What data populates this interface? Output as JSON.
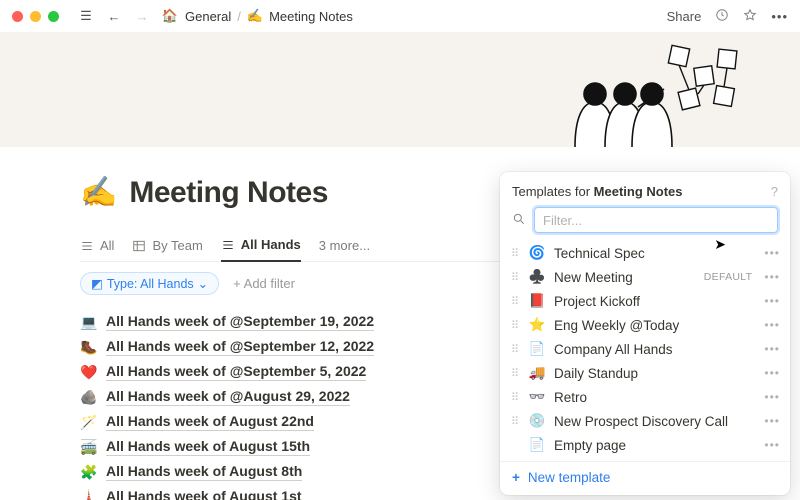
{
  "titlebar": {
    "crumb1": "General",
    "crumb2_icon": "✍️",
    "crumb2": "Meeting Notes",
    "share": "Share"
  },
  "page": {
    "icon": "✍️",
    "title": "Meeting Notes"
  },
  "tabs": {
    "all": "All",
    "byteam": "By Team",
    "allhands": "All Hands",
    "more": "3 more..."
  },
  "filters": {
    "type_label": "Type: All Hands",
    "add": "+  Add filter"
  },
  "entries": [
    {
      "emoji": "💻",
      "text": "All Hands week of @September 19, 2022"
    },
    {
      "emoji": "🥾",
      "text": "All Hands week of @September 12, 2022"
    },
    {
      "emoji": "❤️",
      "text": "All Hands week of @September 5, 2022"
    },
    {
      "emoji": "🪨",
      "text": "All Hands week of @August 29, 2022"
    },
    {
      "emoji": "🪄",
      "text": "All Hands week of August 22nd"
    },
    {
      "emoji": "🚎",
      "text": "All Hands week of August 15th"
    },
    {
      "emoji": "🧩",
      "text": "All Hands week of August 8th"
    },
    {
      "emoji": "🗼",
      "text": "All Hands week of August 1st"
    }
  ],
  "panel": {
    "heading_prefix": "Templates for ",
    "heading_bold": "Meeting Notes",
    "filter_placeholder": "Filter...",
    "default_badge": "DEFAULT",
    "new_template": "New template",
    "templates": [
      {
        "emoji": "🌀",
        "name": "Technical Spec",
        "drag": true,
        "more": true
      },
      {
        "emoji": "♣️",
        "name": "New Meeting",
        "drag": true,
        "more": true,
        "default": true
      },
      {
        "emoji": "📕",
        "name": "Project Kickoff",
        "drag": true,
        "more": true
      },
      {
        "emoji": "⭐",
        "name": "Eng Weekly @Today",
        "drag": true,
        "more": true
      },
      {
        "emoji": "📄",
        "name": "Company All Hands",
        "drag": true,
        "more": true
      },
      {
        "emoji": "🚚",
        "name": "Daily Standup",
        "drag": true,
        "more": true
      },
      {
        "emoji": "👓",
        "name": "Retro",
        "drag": true,
        "more": true
      },
      {
        "emoji": "💿",
        "name": "New Prospect Discovery Call",
        "drag": true,
        "more": true
      },
      {
        "emoji": "📄",
        "name": "Empty page",
        "drag": false,
        "more": true
      }
    ]
  }
}
